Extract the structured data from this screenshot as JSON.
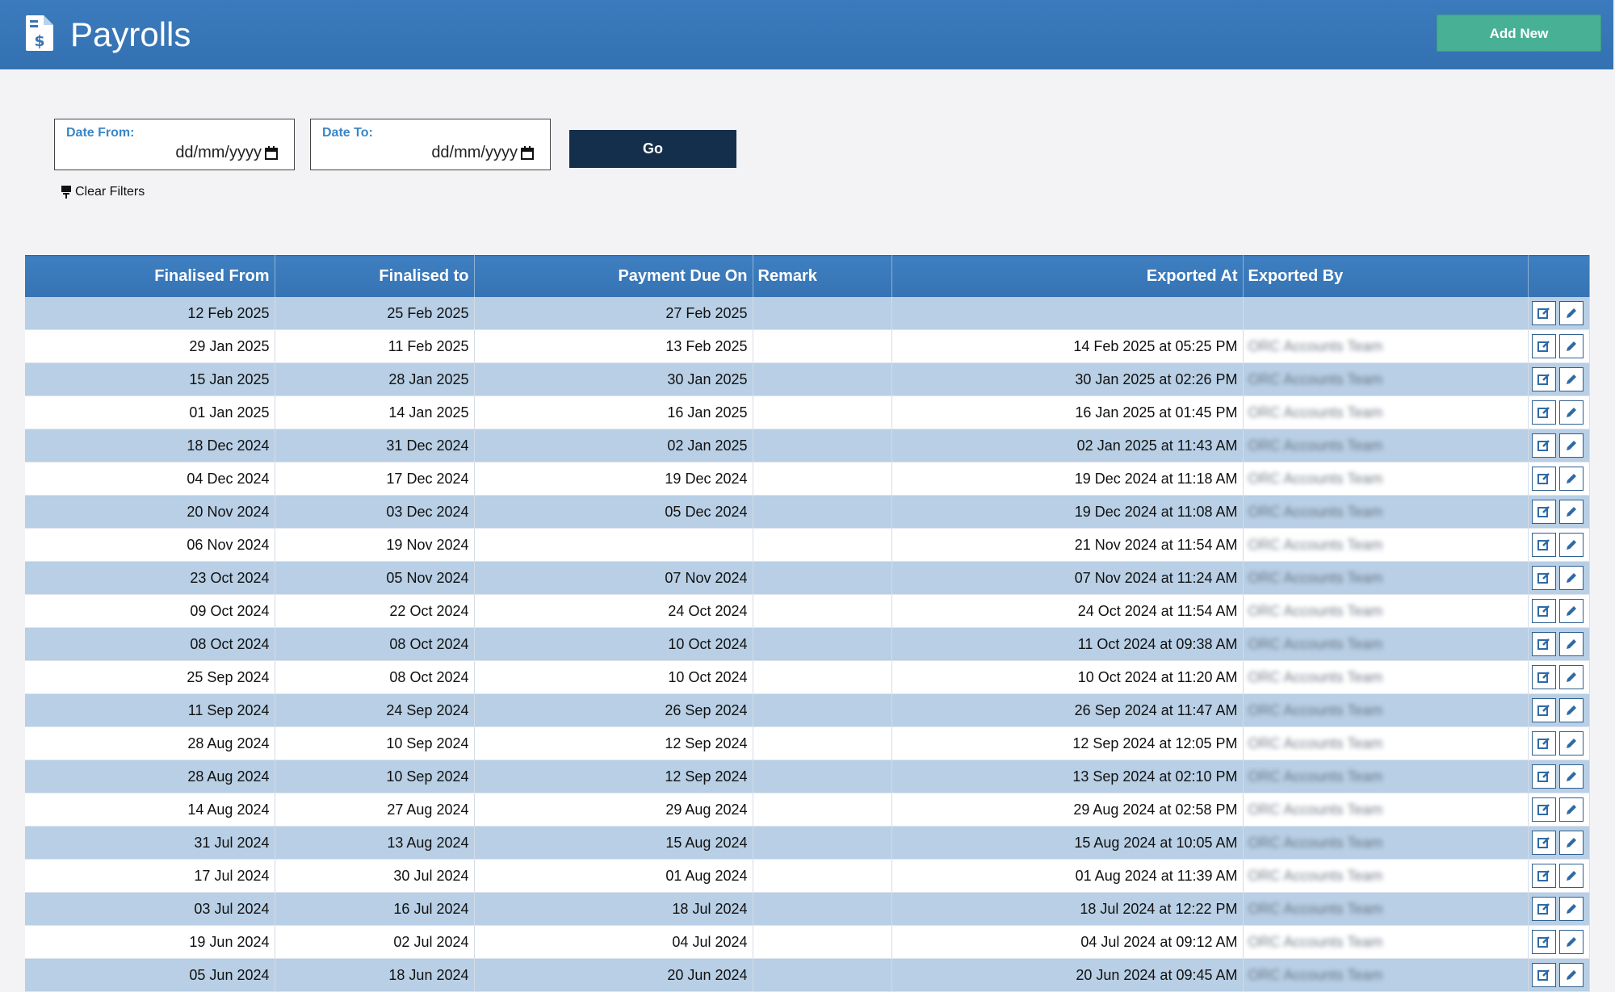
{
  "header": {
    "title": "Payrolls",
    "add_button_label": "Add New",
    "icon": "invoice-dollar-icon"
  },
  "filters": {
    "date_from": {
      "label": "Date From:",
      "value": "dd/mm/yyyy"
    },
    "date_to": {
      "label": "Date To:",
      "value": "dd/mm/yyyy"
    },
    "go_label": "Go",
    "clear_label": "Clear Filters"
  },
  "table": {
    "columns": [
      "Finalised From",
      "Finalised to",
      "Payment Due On",
      "Remark",
      "Exported At",
      "Exported By",
      ""
    ],
    "rows": [
      {
        "finalised_from": "12 Feb 2025",
        "finalised_to": "25 Feb 2025",
        "payment_due_on": "27 Feb 2025",
        "remark": "",
        "exported_at": "",
        "exported_by": ""
      },
      {
        "finalised_from": "29 Jan 2025",
        "finalised_to": "11 Feb 2025",
        "payment_due_on": "13 Feb 2025",
        "remark": "",
        "exported_at": "14 Feb 2025 at 05:25 PM",
        "exported_by": "ORC Accounts Team"
      },
      {
        "finalised_from": "15 Jan 2025",
        "finalised_to": "28 Jan 2025",
        "payment_due_on": "30 Jan 2025",
        "remark": "",
        "exported_at": "30 Jan 2025 at 02:26 PM",
        "exported_by": "ORC Accounts Team"
      },
      {
        "finalised_from": "01 Jan 2025",
        "finalised_to": "14 Jan 2025",
        "payment_due_on": "16 Jan 2025",
        "remark": "",
        "exported_at": "16 Jan 2025 at 01:45 PM",
        "exported_by": "ORC Accounts Team"
      },
      {
        "finalised_from": "18 Dec 2024",
        "finalised_to": "31 Dec 2024",
        "payment_due_on": "02 Jan 2025",
        "remark": "",
        "exported_at": "02 Jan 2025 at 11:43 AM",
        "exported_by": "ORC Accounts Team"
      },
      {
        "finalised_from": "04 Dec 2024",
        "finalised_to": "17 Dec 2024",
        "payment_due_on": "19 Dec 2024",
        "remark": "",
        "exported_at": "19 Dec 2024 at 11:18 AM",
        "exported_by": "ORC Accounts Team"
      },
      {
        "finalised_from": "20 Nov 2024",
        "finalised_to": "03 Dec 2024",
        "payment_due_on": "05 Dec 2024",
        "remark": "",
        "exported_at": "19 Dec 2024 at 11:08 AM",
        "exported_by": "ORC Accounts Team"
      },
      {
        "finalised_from": "06 Nov 2024",
        "finalised_to": "19 Nov 2024",
        "payment_due_on": "",
        "remark": "",
        "exported_at": "21 Nov 2024 at 11:54 AM",
        "exported_by": "ORC Accounts Team"
      },
      {
        "finalised_from": "23 Oct 2024",
        "finalised_to": "05 Nov 2024",
        "payment_due_on": "07 Nov 2024",
        "remark": "",
        "exported_at": "07 Nov 2024 at 11:24 AM",
        "exported_by": "ORC Accounts Team"
      },
      {
        "finalised_from": "09 Oct 2024",
        "finalised_to": "22 Oct 2024",
        "payment_due_on": "24 Oct 2024",
        "remark": "",
        "exported_at": "24 Oct 2024 at 11:54 AM",
        "exported_by": "ORC Accounts Team"
      },
      {
        "finalised_from": "08 Oct 2024",
        "finalised_to": "08 Oct 2024",
        "payment_due_on": "10 Oct 2024",
        "remark": "",
        "exported_at": "11 Oct 2024 at 09:38 AM",
        "exported_by": "ORC Accounts Team"
      },
      {
        "finalised_from": "25 Sep 2024",
        "finalised_to": "08 Oct 2024",
        "payment_due_on": "10 Oct 2024",
        "remark": "",
        "exported_at": "10 Oct 2024 at 11:20 AM",
        "exported_by": "ORC Accounts Team"
      },
      {
        "finalised_from": "11 Sep 2024",
        "finalised_to": "24 Sep 2024",
        "payment_due_on": "26 Sep 2024",
        "remark": "",
        "exported_at": "26 Sep 2024 at 11:47 AM",
        "exported_by": "ORC Accounts Team"
      },
      {
        "finalised_from": "28 Aug 2024",
        "finalised_to": "10 Sep 2024",
        "payment_due_on": "12 Sep 2024",
        "remark": "",
        "exported_at": "12 Sep 2024 at 12:05 PM",
        "exported_by": "ORC Accounts Team"
      },
      {
        "finalised_from": "28 Aug 2024",
        "finalised_to": "10 Sep 2024",
        "payment_due_on": "12 Sep 2024",
        "remark": "",
        "exported_at": "13 Sep 2024 at 02:10 PM",
        "exported_by": "ORC Accounts Team"
      },
      {
        "finalised_from": "14 Aug 2024",
        "finalised_to": "27 Aug 2024",
        "payment_due_on": "29 Aug 2024",
        "remark": "",
        "exported_at": "29 Aug 2024 at 02:58 PM",
        "exported_by": "ORC Accounts Team"
      },
      {
        "finalised_from": "31 Jul 2024",
        "finalised_to": "13 Aug 2024",
        "payment_due_on": "15 Aug 2024",
        "remark": "",
        "exported_at": "15 Aug 2024 at 10:05 AM",
        "exported_by": "ORC Accounts Team"
      },
      {
        "finalised_from": "17 Jul 2024",
        "finalised_to": "30 Jul 2024",
        "payment_due_on": "01 Aug 2024",
        "remark": "",
        "exported_at": "01 Aug 2024 at 11:39 AM",
        "exported_by": "ORC Accounts Team"
      },
      {
        "finalised_from": "03 Jul 2024",
        "finalised_to": "16 Jul 2024",
        "payment_due_on": "18 Jul 2024",
        "remark": "",
        "exported_at": "18 Jul 2024 at 12:22 PM",
        "exported_by": "ORC Accounts Team"
      },
      {
        "finalised_from": "19 Jun 2024",
        "finalised_to": "02 Jul 2024",
        "payment_due_on": "04 Jul 2024",
        "remark": "",
        "exported_at": "04 Jul 2024 at 09:12 AM",
        "exported_by": "ORC Accounts Team"
      },
      {
        "finalised_from": "05 Jun 2024",
        "finalised_to": "18 Jun 2024",
        "payment_due_on": "20 Jun 2024",
        "remark": "",
        "exported_at": "20 Jun 2024 at 09:45 AM",
        "exported_by": "ORC Accounts Team"
      }
    ],
    "row_actions": [
      "edit-square-icon",
      "pencil-icon"
    ]
  },
  "colors": {
    "header_bg": "#3775b6",
    "add_button": "#48b094",
    "go_button": "#142f4c",
    "row_alt": "#b8cfe5"
  }
}
